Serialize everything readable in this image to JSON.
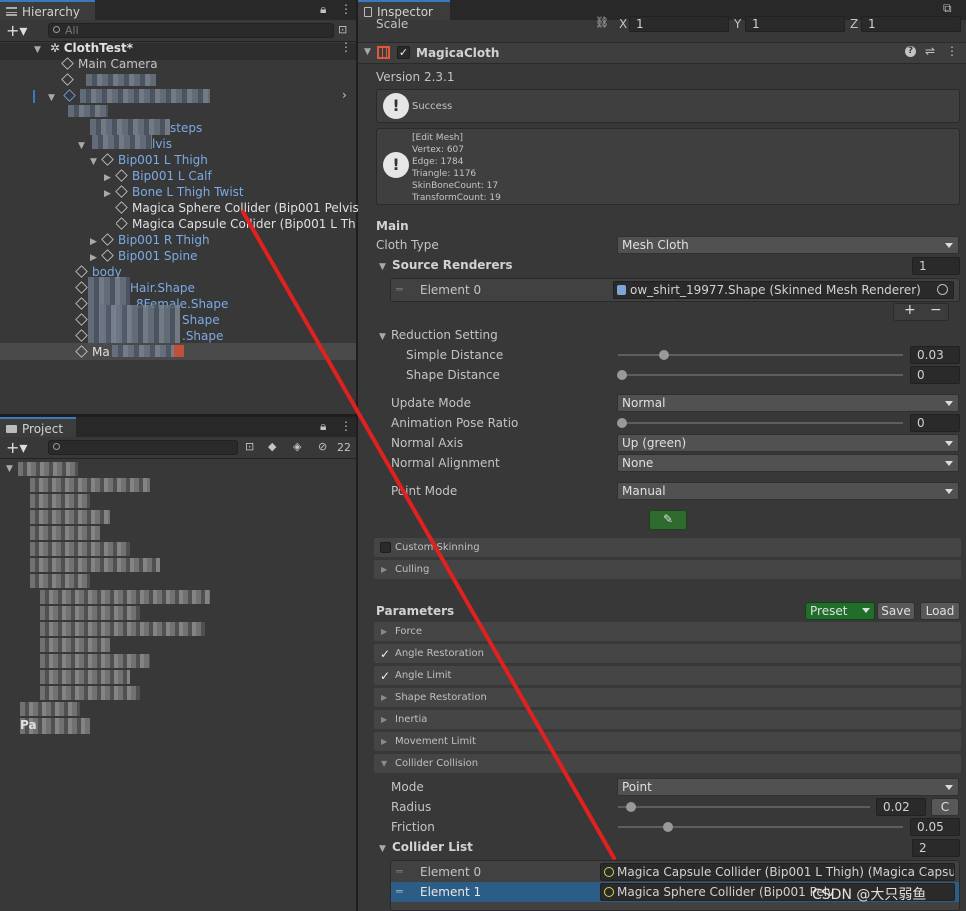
{
  "hierarchy": {
    "tab_label": "Hierarchy",
    "search_placeholder": "All",
    "scene_name": "ClothTest*",
    "items": {
      "main_camera": "Main Camera",
      "steps": "steps",
      "pelvis": "lvis",
      "l_thigh": "Bip001 L Thigh",
      "l_calf": "Bip001 L Calf",
      "bone_l_thigh_twist": "Bone L Thigh Twist",
      "sphere_collider": "Magica Sphere Collider (Bip001 Pelvis)",
      "capsule_collider": "Magica Capsule Collider (Bip001 L Thig",
      "r_thigh": "Bip001 R Thigh",
      "spine": "Bip001 Spine",
      "body": "body",
      "hair_shape": "Hair.Shape",
      "female_shape": "8Female.Shape",
      "shape_a": "Shape",
      "shape_b": ".Shape",
      "ma": "Ma"
    }
  },
  "project": {
    "tab_label": "Project",
    "hidden_count": "22",
    "partial_label": "Pa"
  },
  "inspector": {
    "tab_label": "Inspector",
    "scale": {
      "label": "Scale",
      "x_label": "X",
      "x": "1",
      "y_label": "Y",
      "y": "1",
      "z_label": "Z",
      "z": "1"
    },
    "component_title": "MagicaCloth",
    "version": "Version 2.3.1",
    "success_message": "Success",
    "mesh_info": [
      "[Edit Mesh]",
      "Vertex: 607",
      "Edge: 1784",
      "Triangle: 1176",
      "SkinBoneCount: 17",
      "TransformCount: 19"
    ],
    "main_header": "Main",
    "cloth_type_label": "Cloth Type",
    "cloth_type_value": "Mesh Cloth",
    "source_renderers_label": "Source Renderers",
    "source_renderers_count": "1",
    "element0_label": "Element 0",
    "element0_value": "ow_shirt_19977.Shape (Skinned Mesh Renderer)",
    "reduction_setting_label": "Reduction Setting",
    "simple_distance_label": "Simple Distance",
    "simple_distance_value": "0.03",
    "shape_distance_label": "Shape Distance",
    "shape_distance_value": "0",
    "update_mode_label": "Update Mode",
    "update_mode_value": "Normal",
    "animation_pose_ratio_label": "Animation Pose Ratio",
    "animation_pose_ratio_value": "0",
    "normal_axis_label": "Normal Axis",
    "normal_axis_value": "Up (green)",
    "normal_alignment_label": "Normal Alignment",
    "normal_alignment_value": "None",
    "point_mode_label": "Point Mode",
    "point_mode_value": "Manual",
    "custom_skinning_label": "Custom Skinning",
    "culling_label": "Culling",
    "parameters_header": "Parameters",
    "preset_label": "Preset",
    "save_label": "Save",
    "load_label": "Load",
    "param_folds": {
      "force": "Force",
      "angle_restoration": "Angle Restoration",
      "angle_limit": "Angle Limit",
      "shape_restoration": "Shape Restoration",
      "inertia": "Inertia",
      "movement_limit": "Movement Limit",
      "collider_collision": "Collider Collision"
    },
    "mode_label": "Mode",
    "mode_value": "Point",
    "radius_label": "Radius",
    "radius_value": "0.02",
    "radius_curve_btn": "C",
    "friction_label": "Friction",
    "friction_value": "0.05",
    "collider_list_label": "Collider List",
    "collider_list_count": "2",
    "collider_element0_label": "Element 0",
    "collider_element0_value": "Magica Capsule Collider (Bip001 L Thigh) (Magica Capsu",
    "collider_element1_label": "Element 1",
    "collider_element1_value": "Magica Sphere Collider (Bip001 Pelv",
    "watermark": "CSDN @大只弱鱼",
    "accent_color": "#3a79bb",
    "annotation_color": "#e0211f"
  }
}
